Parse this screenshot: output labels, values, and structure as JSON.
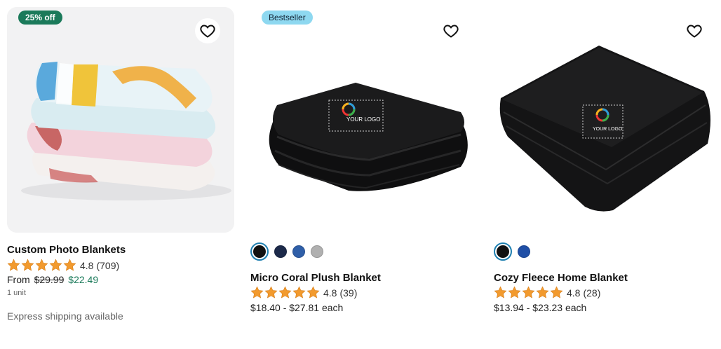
{
  "products": [
    {
      "title": "Custom Photo Blankets",
      "badge": "25% off",
      "rating_value": "4.8",
      "review_count": "(709)",
      "price_prefix": "From",
      "old_price": "$29.99",
      "new_price": "$22.49",
      "unit": "1 unit",
      "shipping": "Express shipping available",
      "stars": 5
    },
    {
      "title": "Micro Coral Plush Blanket",
      "badge": "Bestseller",
      "logo_text": "YOUR LOGO",
      "rating_value": "4.8",
      "review_count": "(39)",
      "price_range": "$18.40 - $27.81 each",
      "stars": 5,
      "swatches": [
        "#111111",
        "#1c2a4a",
        "#2f5fa8",
        "#b0b0b0"
      ]
    },
    {
      "title": "Cozy Fleece Home Blanket",
      "logo_text": "YOUR LOGO",
      "rating_value": "4.8",
      "review_count": "(28)",
      "price_range": "$13.94 - $23.23 each",
      "stars": 5,
      "swatches": [
        "#111111",
        "#1f4fa6"
      ]
    }
  ],
  "colors": {
    "sale_badge": "#1b7a5a",
    "bestseller_badge": "#8ed8f0",
    "star": "#f29a2e",
    "sale_price": "#1b7a5a",
    "selected_ring": "#1e7fb0"
  },
  "icons": {
    "favorite": "heart-outline-icon",
    "star": "star-icon"
  }
}
